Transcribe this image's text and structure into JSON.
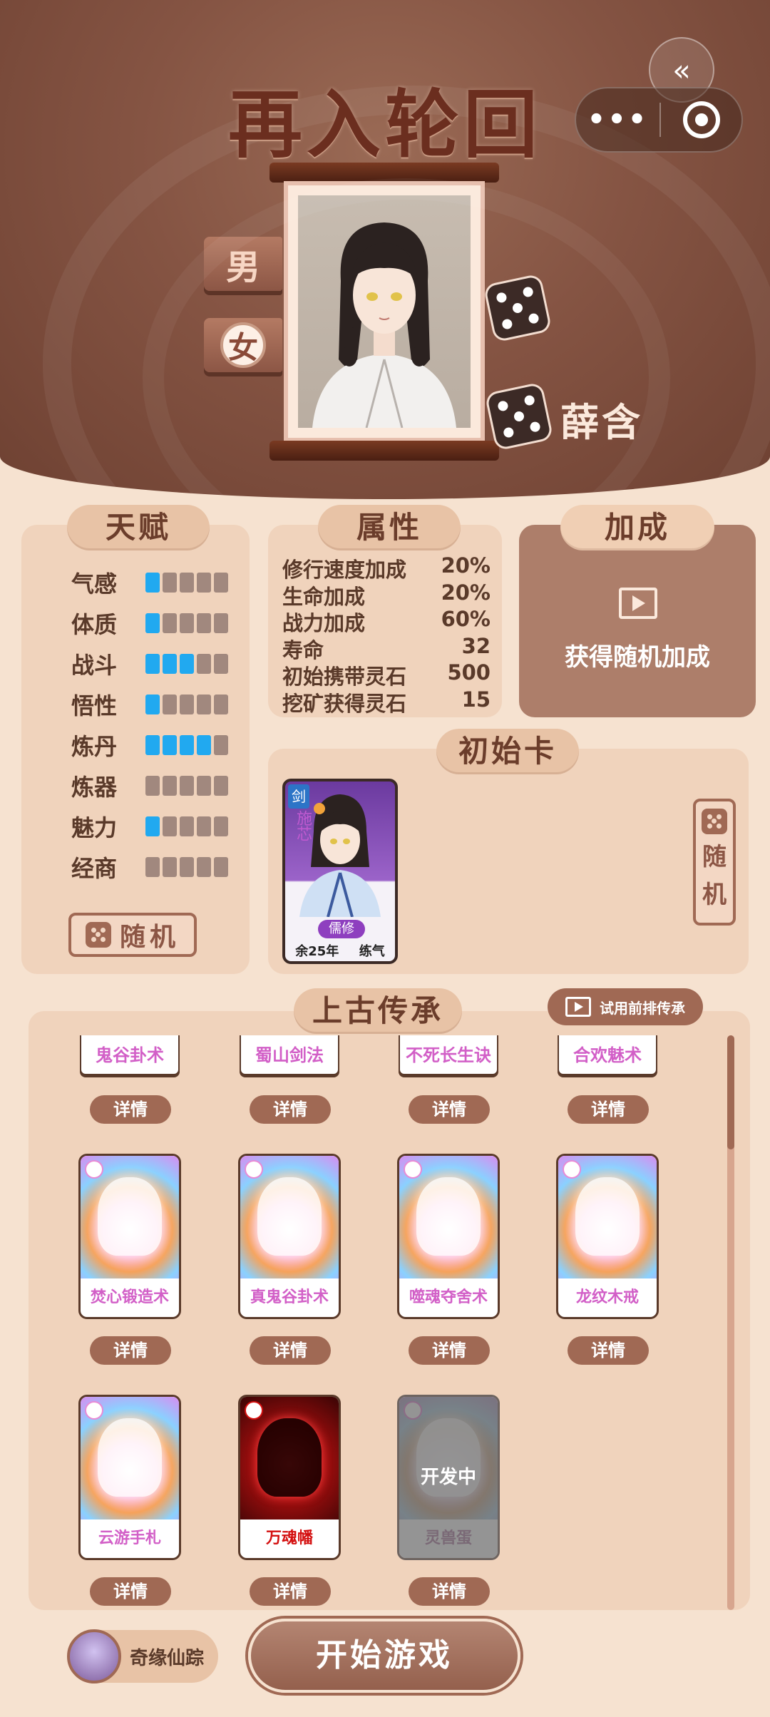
{
  "header": {
    "title": "再入轮回",
    "capsule_more": "•••",
    "back_icon": "chevron-double-left-icon"
  },
  "character": {
    "gender_male": "男",
    "gender_female": "女",
    "selected_gender": "女",
    "name": "薛含"
  },
  "talent": {
    "title": "天赋",
    "items": [
      {
        "label": "气感",
        "level": 1,
        "max": 5
      },
      {
        "label": "体质",
        "level": 1,
        "max": 5
      },
      {
        "label": "战斗",
        "level": 3,
        "max": 5
      },
      {
        "label": "悟性",
        "level": 1,
        "max": 5
      },
      {
        "label": "炼丹",
        "level": 4,
        "max": 5
      },
      {
        "label": "炼器",
        "level": 0,
        "max": 5
      },
      {
        "label": "魅力",
        "level": 1,
        "max": 5
      },
      {
        "label": "经商",
        "level": 0,
        "max": 5
      }
    ],
    "random_label": "随机"
  },
  "attributes": {
    "title": "属性",
    "items": [
      {
        "label": "修行速度加成",
        "value": "20%"
      },
      {
        "label": "生命加成",
        "value": "20%"
      },
      {
        "label": "战力加成",
        "value": "60%"
      },
      {
        "label": "寿命",
        "value": "32"
      },
      {
        "label": "初始携带灵石",
        "value": "500"
      },
      {
        "label": "挖矿获得灵石",
        "value": "15"
      }
    ]
  },
  "bonus": {
    "title": "加成",
    "action": "获得随机加成"
  },
  "start_card": {
    "title": "初始卡",
    "badge": "剑",
    "name": "施芯",
    "role": "儒修",
    "remaining": "余25年",
    "realm": "练气",
    "random_label": [
      "随",
      "机"
    ]
  },
  "heritage": {
    "title": "上古传承",
    "try_label": "试用前排传承",
    "top_row": [
      "鬼谷卦术",
      "蜀山剑法",
      "不死长生诀",
      "合欢魅术"
    ],
    "detail_label": "详情",
    "cards": [
      {
        "name": "焚心锻造术",
        "style": "light"
      },
      {
        "name": "真鬼谷卦术",
        "style": "light"
      },
      {
        "name": "噬魂夺舍术",
        "style": "light"
      },
      {
        "name": "龙纹木戒",
        "style": "light"
      },
      {
        "name": "云游手札",
        "style": "light"
      },
      {
        "name": "万魂幡",
        "style": "dark"
      },
      {
        "name": "灵兽蛋",
        "style": "dev",
        "status": "开发中"
      }
    ]
  },
  "bottom": {
    "qiyuan": "奇缘仙踪",
    "start": "开始游戏"
  }
}
